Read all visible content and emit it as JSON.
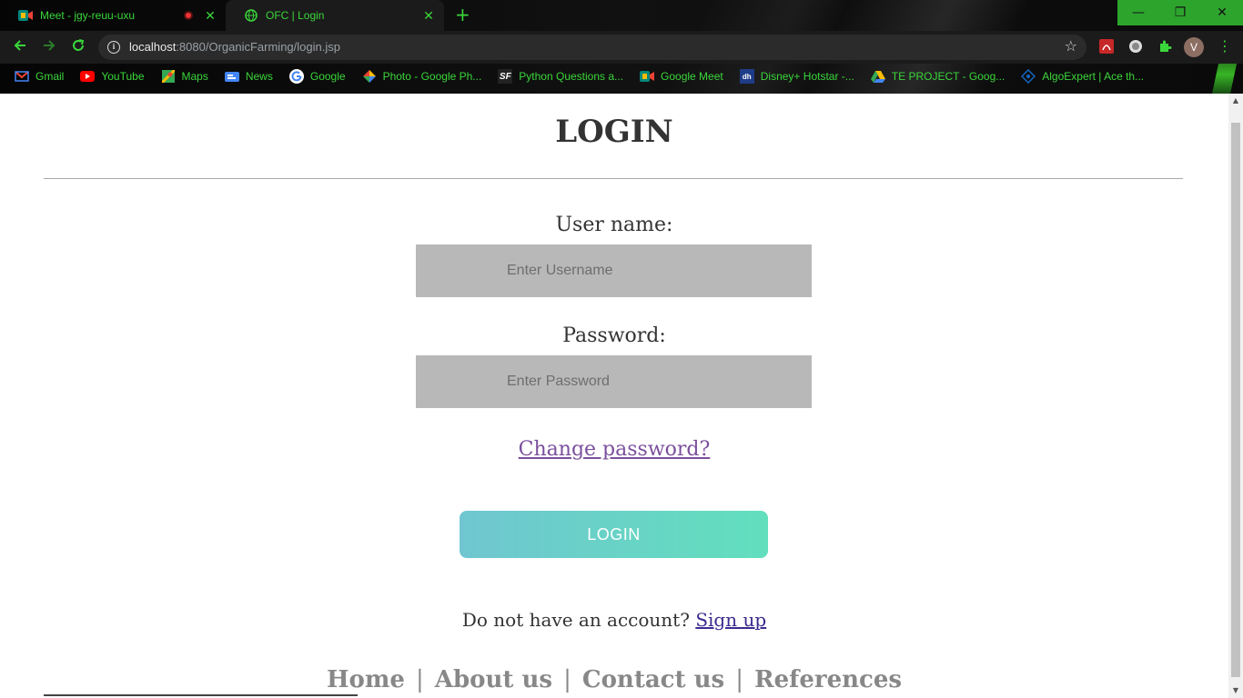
{
  "browser": {
    "tabs": [
      {
        "title": "Meet - jgy-reuu-uxu",
        "recording": true,
        "close": "✕"
      },
      {
        "title": "OFC | Login",
        "active": true,
        "close": "✕"
      }
    ],
    "new_tab": "+",
    "window_controls": {
      "minimize": "—",
      "restore": "❐",
      "close": "✕"
    },
    "url_host": "localhost",
    "url_path": ":8080/OrganicFarming/login.jsp",
    "profile_initial": "V",
    "bookmarks": [
      {
        "label": "Gmail",
        "icon": "gmail-icon",
        "color": "#ea4335"
      },
      {
        "label": "YouTube",
        "icon": "youtube-icon",
        "color": "#ff0000"
      },
      {
        "label": "Maps",
        "icon": "maps-icon",
        "color": "#34a853"
      },
      {
        "label": "News",
        "icon": "news-icon",
        "color": "#4285f4"
      },
      {
        "label": "Google",
        "icon": "google-icon",
        "color": "#4285f4"
      },
      {
        "label": "Photo - Google Ph...",
        "icon": "photos-icon",
        "color": "#fbbc05"
      },
      {
        "label": "Python Questions a...",
        "icon": "sf-icon",
        "color": "#ffffff"
      },
      {
        "label": "Google Meet",
        "icon": "meet-icon",
        "color": "#00897b"
      },
      {
        "label": "Disney+ Hotstar -...",
        "icon": "hotstar-icon",
        "color": "#1f3c88"
      },
      {
        "label": "TE PROJECT - Goog...",
        "icon": "drive-icon",
        "color": "#fbbc05"
      },
      {
        "label": "AlgoExpert | Ace th...",
        "icon": "algoexpert-icon",
        "color": "#1565c0"
      }
    ]
  },
  "page": {
    "title": "LOGIN",
    "username_label": "User name:",
    "username_placeholder": "Enter Username",
    "password_label": "Password:",
    "password_placeholder": "Enter Password",
    "change_password": "Change password?",
    "login_button": "LOGIN",
    "signup_prompt": "Do not have an account?",
    "signup_link": "Sign up",
    "footer": [
      {
        "label": "Home"
      },
      {
        "label": "About us"
      },
      {
        "label": "Contact us"
      },
      {
        "label": "References"
      }
    ],
    "footer_separator": "|"
  },
  "colors": {
    "accent_green": "#3ad63a",
    "login_gradient_start": "#6fc6d0",
    "login_gradient_end": "#62dfbd",
    "input_bg": "#b8b8b8"
  }
}
